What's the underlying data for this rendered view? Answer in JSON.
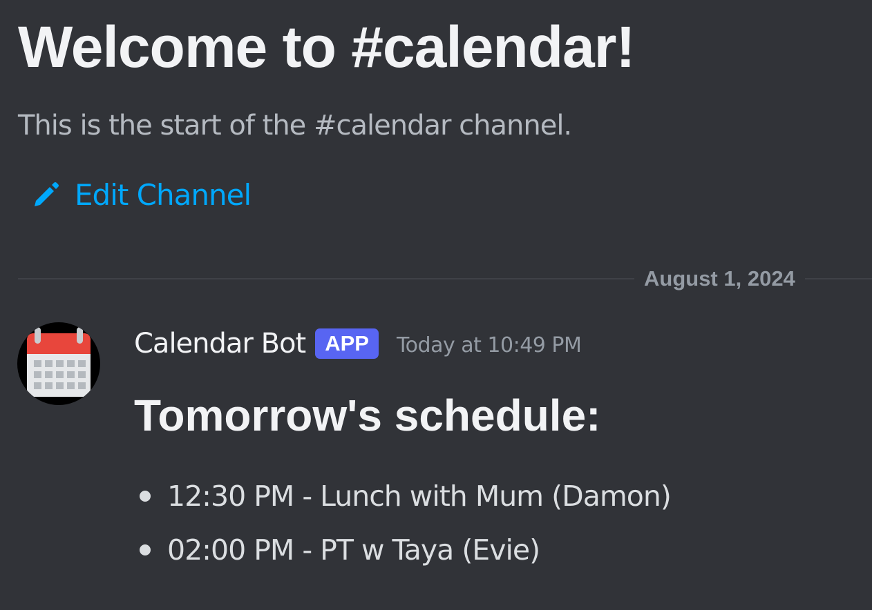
{
  "channel_intro": {
    "title": "Welcome to #calendar!",
    "subtitle": "This is the start of the #calendar channel.",
    "edit_icon": "pencil-icon",
    "edit_label": "Edit Channel"
  },
  "divider": {
    "date": "August 1, 2024"
  },
  "message": {
    "avatar_icon": "calendar-icon",
    "author": "Calendar Bot",
    "badge": "APP",
    "timestamp": "Today at 10:49 PM",
    "heading": "Tomorrow's schedule:",
    "items": [
      "12:30 PM - Lunch with Mum (Damon)",
      "02:00 PM - PT w Taya (Evie)"
    ]
  },
  "colors": {
    "background": "#313338",
    "link": "#00a8fc",
    "badge": "#5865f2",
    "muted_text": "#949ba4"
  }
}
